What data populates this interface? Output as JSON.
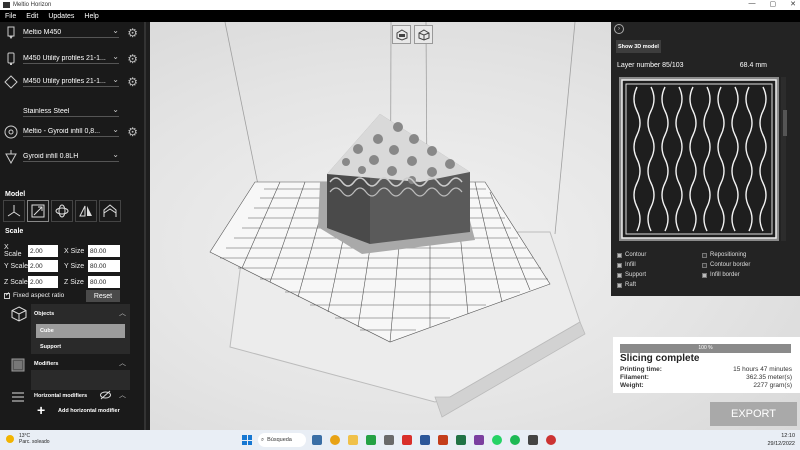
{
  "titlebar": {
    "title": "Meltio Horizon",
    "controls": [
      "—",
      "▢",
      "✕"
    ]
  },
  "menu": [
    "File",
    "Edit",
    "Updates",
    "Help"
  ],
  "left_panel": {
    "printer": "Meltio M450",
    "profile1": "M450 Utility profiles 21-1...",
    "profile2": "M450 Utility profiles 21-1...",
    "material": "Stainless Steel",
    "infill_profile": "Meltio - Gyroid infill 0,8...",
    "layer_profile": "Gyroid infill 0.8LH",
    "model_label": "Model",
    "scale_label": "Scale",
    "x_scale_label": "X Scale",
    "x_scale": "2.00",
    "x_size_label": "X Size",
    "x_size": "80.00",
    "y_scale_label": "Y Scale",
    "y_scale": "2.00",
    "y_size_label": "Y Size",
    "y_size": "80.00",
    "z_scale_label": "Z Scale",
    "z_scale": "2.00",
    "z_size_label": "Z Size",
    "z_size": "80.00",
    "fixed_aspect_label": "Fixed aspect ratio",
    "fixed_aspect_checked": true,
    "reset_label": "Reset",
    "objects_header": "Objects",
    "objects": [
      "Cube",
      "Support"
    ],
    "modifiers_header": "Modifiers",
    "horizontal_modifiers_header": "Horizontal modifiers",
    "add_horizontal_modifier": "Add horizontal modifier"
  },
  "right_panel": {
    "show3d_label": "Show 3D model",
    "layer_label": "Layer number 85/103",
    "layer_height": "68.4 mm",
    "legend": [
      {
        "label": "Contour",
        "checked": true
      },
      {
        "label": "Repositioning",
        "checked": false
      },
      {
        "label": "Infill",
        "checked": true
      },
      {
        "label": "Contour border",
        "checked": false
      },
      {
        "label": "Support",
        "checked": true
      },
      {
        "label": "Infill border",
        "checked": true
      },
      {
        "label": "Raft",
        "checked": true
      }
    ]
  },
  "slicing": {
    "progress_text": "100 %",
    "progress": 1.0,
    "title": "Slicing complete",
    "printing_time_label": "Printing time:",
    "printing_time": "15 hours 47 minutes",
    "filament_label": "Filament:",
    "filament": "362.35  meter(s)",
    "weight_label": "Weight:",
    "weight": "2277  gram(s)"
  },
  "export_label": "EXPORT",
  "taskbar": {
    "weather_temp": "13°C",
    "weather_desc": "Parc. soleado",
    "search_label": "Búsqueda",
    "time": "12:10",
    "date": "29/12/2022"
  }
}
